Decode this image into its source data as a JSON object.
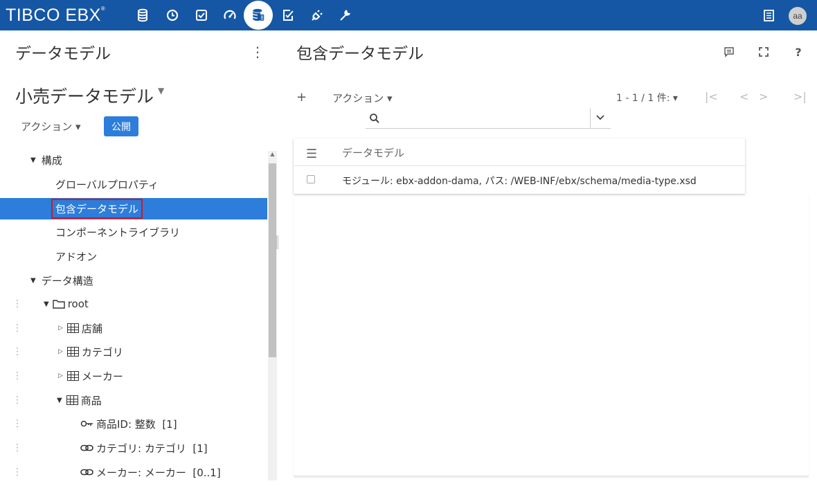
{
  "brand": {
    "logo": "TIBCO EBX",
    "mark": "®"
  },
  "topnav": {
    "icons": [
      "database-icon",
      "clock-icon",
      "checklist-icon",
      "speedometer-icon",
      "data-model-icon",
      "edit-check-icon",
      "plug-icon",
      "wrench-icon"
    ],
    "active": "data-model-icon",
    "right_icons": [
      "list-icon"
    ],
    "avatar": "aa"
  },
  "left_panel": {
    "title": "データモデル",
    "model_name": "小売データモデル",
    "action_label": "アクション ▾",
    "publish_label": "公開",
    "tree": [
      {
        "label": "構成",
        "level": 0,
        "type": "group",
        "expanded": true
      },
      {
        "label": "グローバルプロパティ",
        "level": 1,
        "type": "item"
      },
      {
        "label": "包含データモデル",
        "level": 1,
        "type": "item",
        "selected": true
      },
      {
        "label": "コンポーネントライブラリ",
        "level": 1,
        "type": "item"
      },
      {
        "label": "アドオン",
        "level": 1,
        "type": "item"
      },
      {
        "label": "データ構造",
        "level": 0,
        "type": "group",
        "expanded": true
      },
      {
        "label": "root",
        "level": 1,
        "type": "folder",
        "expanded": true
      },
      {
        "label": "店舗",
        "level": 2,
        "type": "table",
        "expanded": false
      },
      {
        "label": "カテゴリ",
        "level": 2,
        "type": "table",
        "expanded": false
      },
      {
        "label": "メーカー",
        "level": 2,
        "type": "table",
        "expanded": false
      },
      {
        "label": "商品",
        "level": 2,
        "type": "table",
        "expanded": true
      },
      {
        "label": "商品ID: 整数  [1]",
        "level": 3,
        "type": "key"
      },
      {
        "label": "カテゴリ: カテゴリ  [1]",
        "level": 3,
        "type": "link"
      },
      {
        "label": "メーカー: メーカー  [0..1]",
        "level": 3,
        "type": "link"
      }
    ]
  },
  "right_panel": {
    "title": "包含データモデル",
    "header_icons": [
      "comment-icon",
      "fullscreen-icon",
      "help-icon"
    ],
    "help_label": "?",
    "add_label": "+",
    "action_label": "アクション ▾",
    "pager_label": "1 - 1 / 1 件: ▾",
    "pager_icons": [
      "first-page-icon",
      "prev-page-icon",
      "next-page-icon",
      "last-page-icon"
    ],
    "search": {
      "value": ""
    },
    "grid": {
      "column": "データモデル",
      "rows": [
        "モジュール: ebx-addon-dama, パス: /WEB-INF/ebx/schema/media-type.xsd"
      ]
    }
  }
}
